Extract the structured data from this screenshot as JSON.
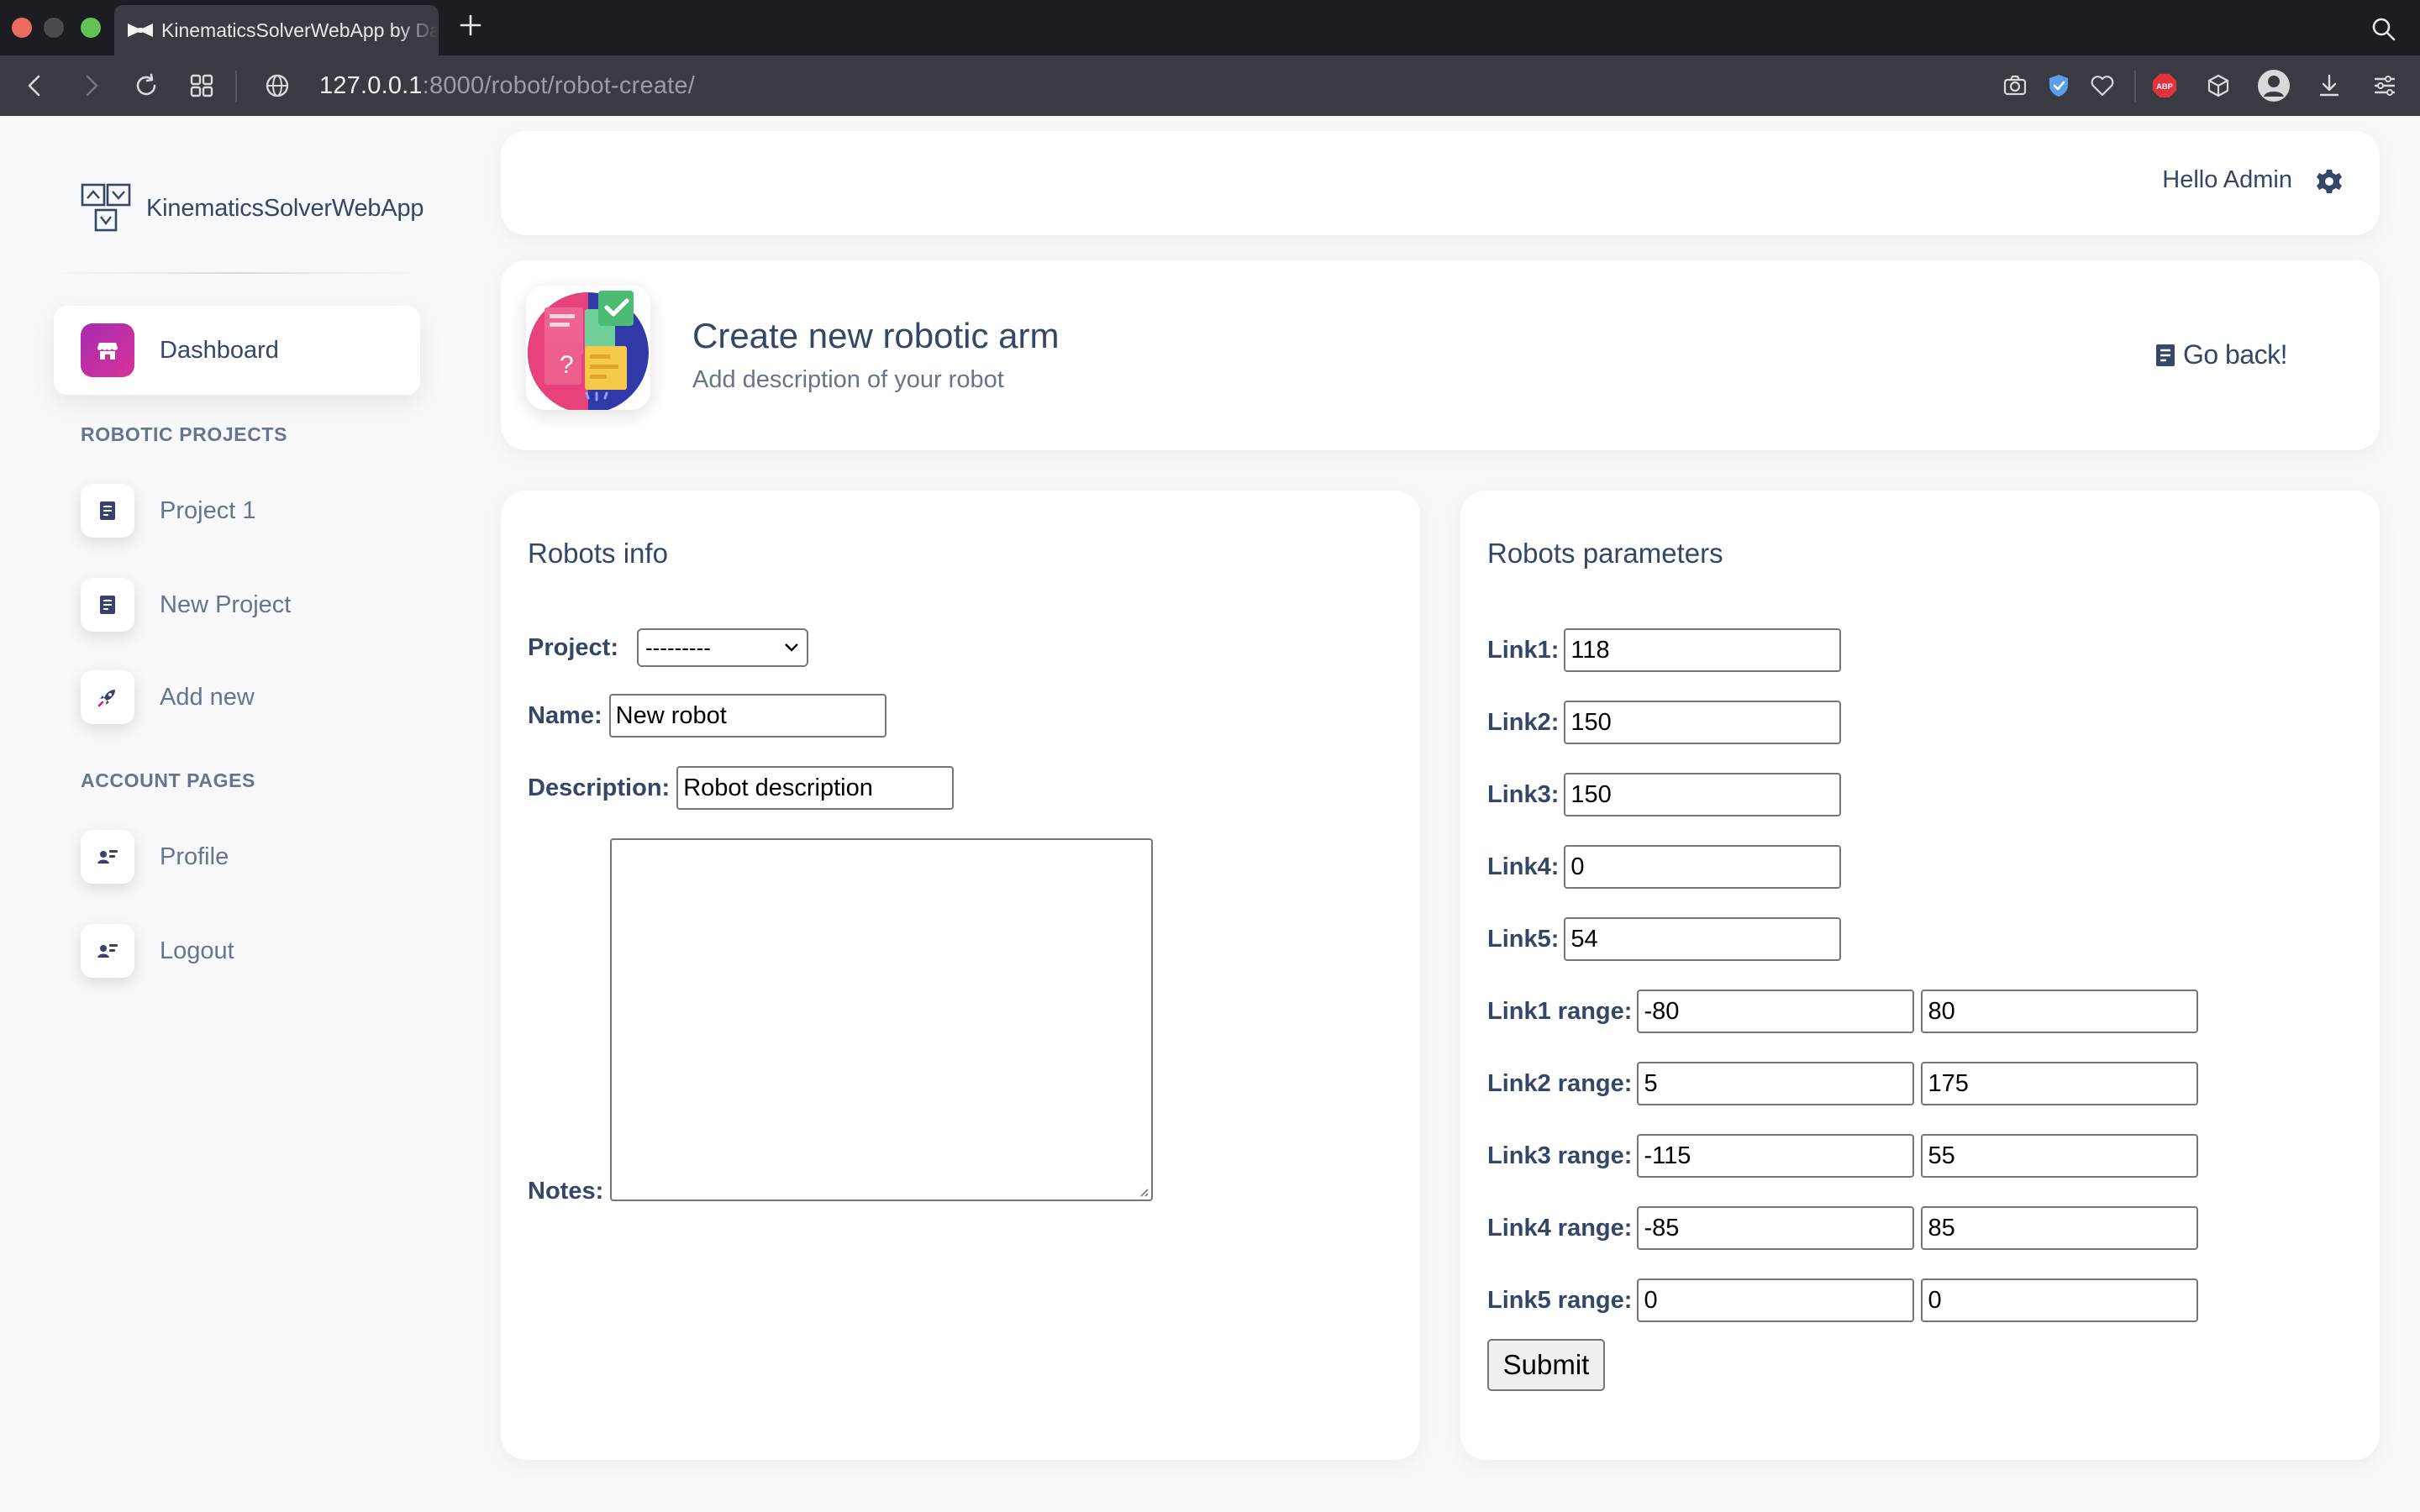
{
  "browser": {
    "tab_title": "KinematicsSolverWebApp by Da",
    "url_host": "127.0.0.1",
    "url_path": ":8000/robot/robot-create/"
  },
  "sidebar": {
    "brand": "KinematicsSolverWebApp",
    "dashboard_label": "Dashboard",
    "section_projects": "ROBOTIC PROJECTS",
    "projects": [
      {
        "label": "Project 1",
        "icon": "document-icon"
      },
      {
        "label": "New Project",
        "icon": "document-icon"
      },
      {
        "label": "Add new",
        "icon": "rocket-icon"
      }
    ],
    "section_account": "ACCOUNT PAGES",
    "account": [
      {
        "label": "Profile",
        "icon": "user-card-icon"
      },
      {
        "label": "Logout",
        "icon": "user-card-icon"
      }
    ]
  },
  "topbar": {
    "greeting": "Hello Admin"
  },
  "header": {
    "title": "Create new robotic arm",
    "subtitle": "Add description of your robot",
    "goback": "Go back!"
  },
  "info": {
    "title": "Robots info",
    "project_label": "Project:",
    "project_value": "---------",
    "name_label": "Name:",
    "name_value": "New robot",
    "description_label": "Description:",
    "description_value": "Robot description",
    "notes_label": "Notes:"
  },
  "params": {
    "title": "Robots parameters",
    "links": [
      {
        "label": "Link1:",
        "value": "118"
      },
      {
        "label": "Link2:",
        "value": "150"
      },
      {
        "label": "Link3:",
        "value": "150"
      },
      {
        "label": "Link4:",
        "value": "0"
      },
      {
        "label": "Link5:",
        "value": "54"
      }
    ],
    "ranges": [
      {
        "label": "Link1 range:",
        "min": "-80",
        "max": "80"
      },
      {
        "label": "Link2 range:",
        "min": "5",
        "max": "175"
      },
      {
        "label": "Link3 range:",
        "min": "-115",
        "max": "55"
      },
      {
        "label": "Link4 range:",
        "min": "-85",
        "max": "85"
      },
      {
        "label": "Link5 range:",
        "min": "0",
        "max": "0"
      }
    ],
    "submit": "Submit"
  },
  "colors": {
    "accent": "#cb0c9f",
    "text_dark": "#344767",
    "text_muted": "#67748e",
    "page_bg": "#f8f9fa"
  }
}
